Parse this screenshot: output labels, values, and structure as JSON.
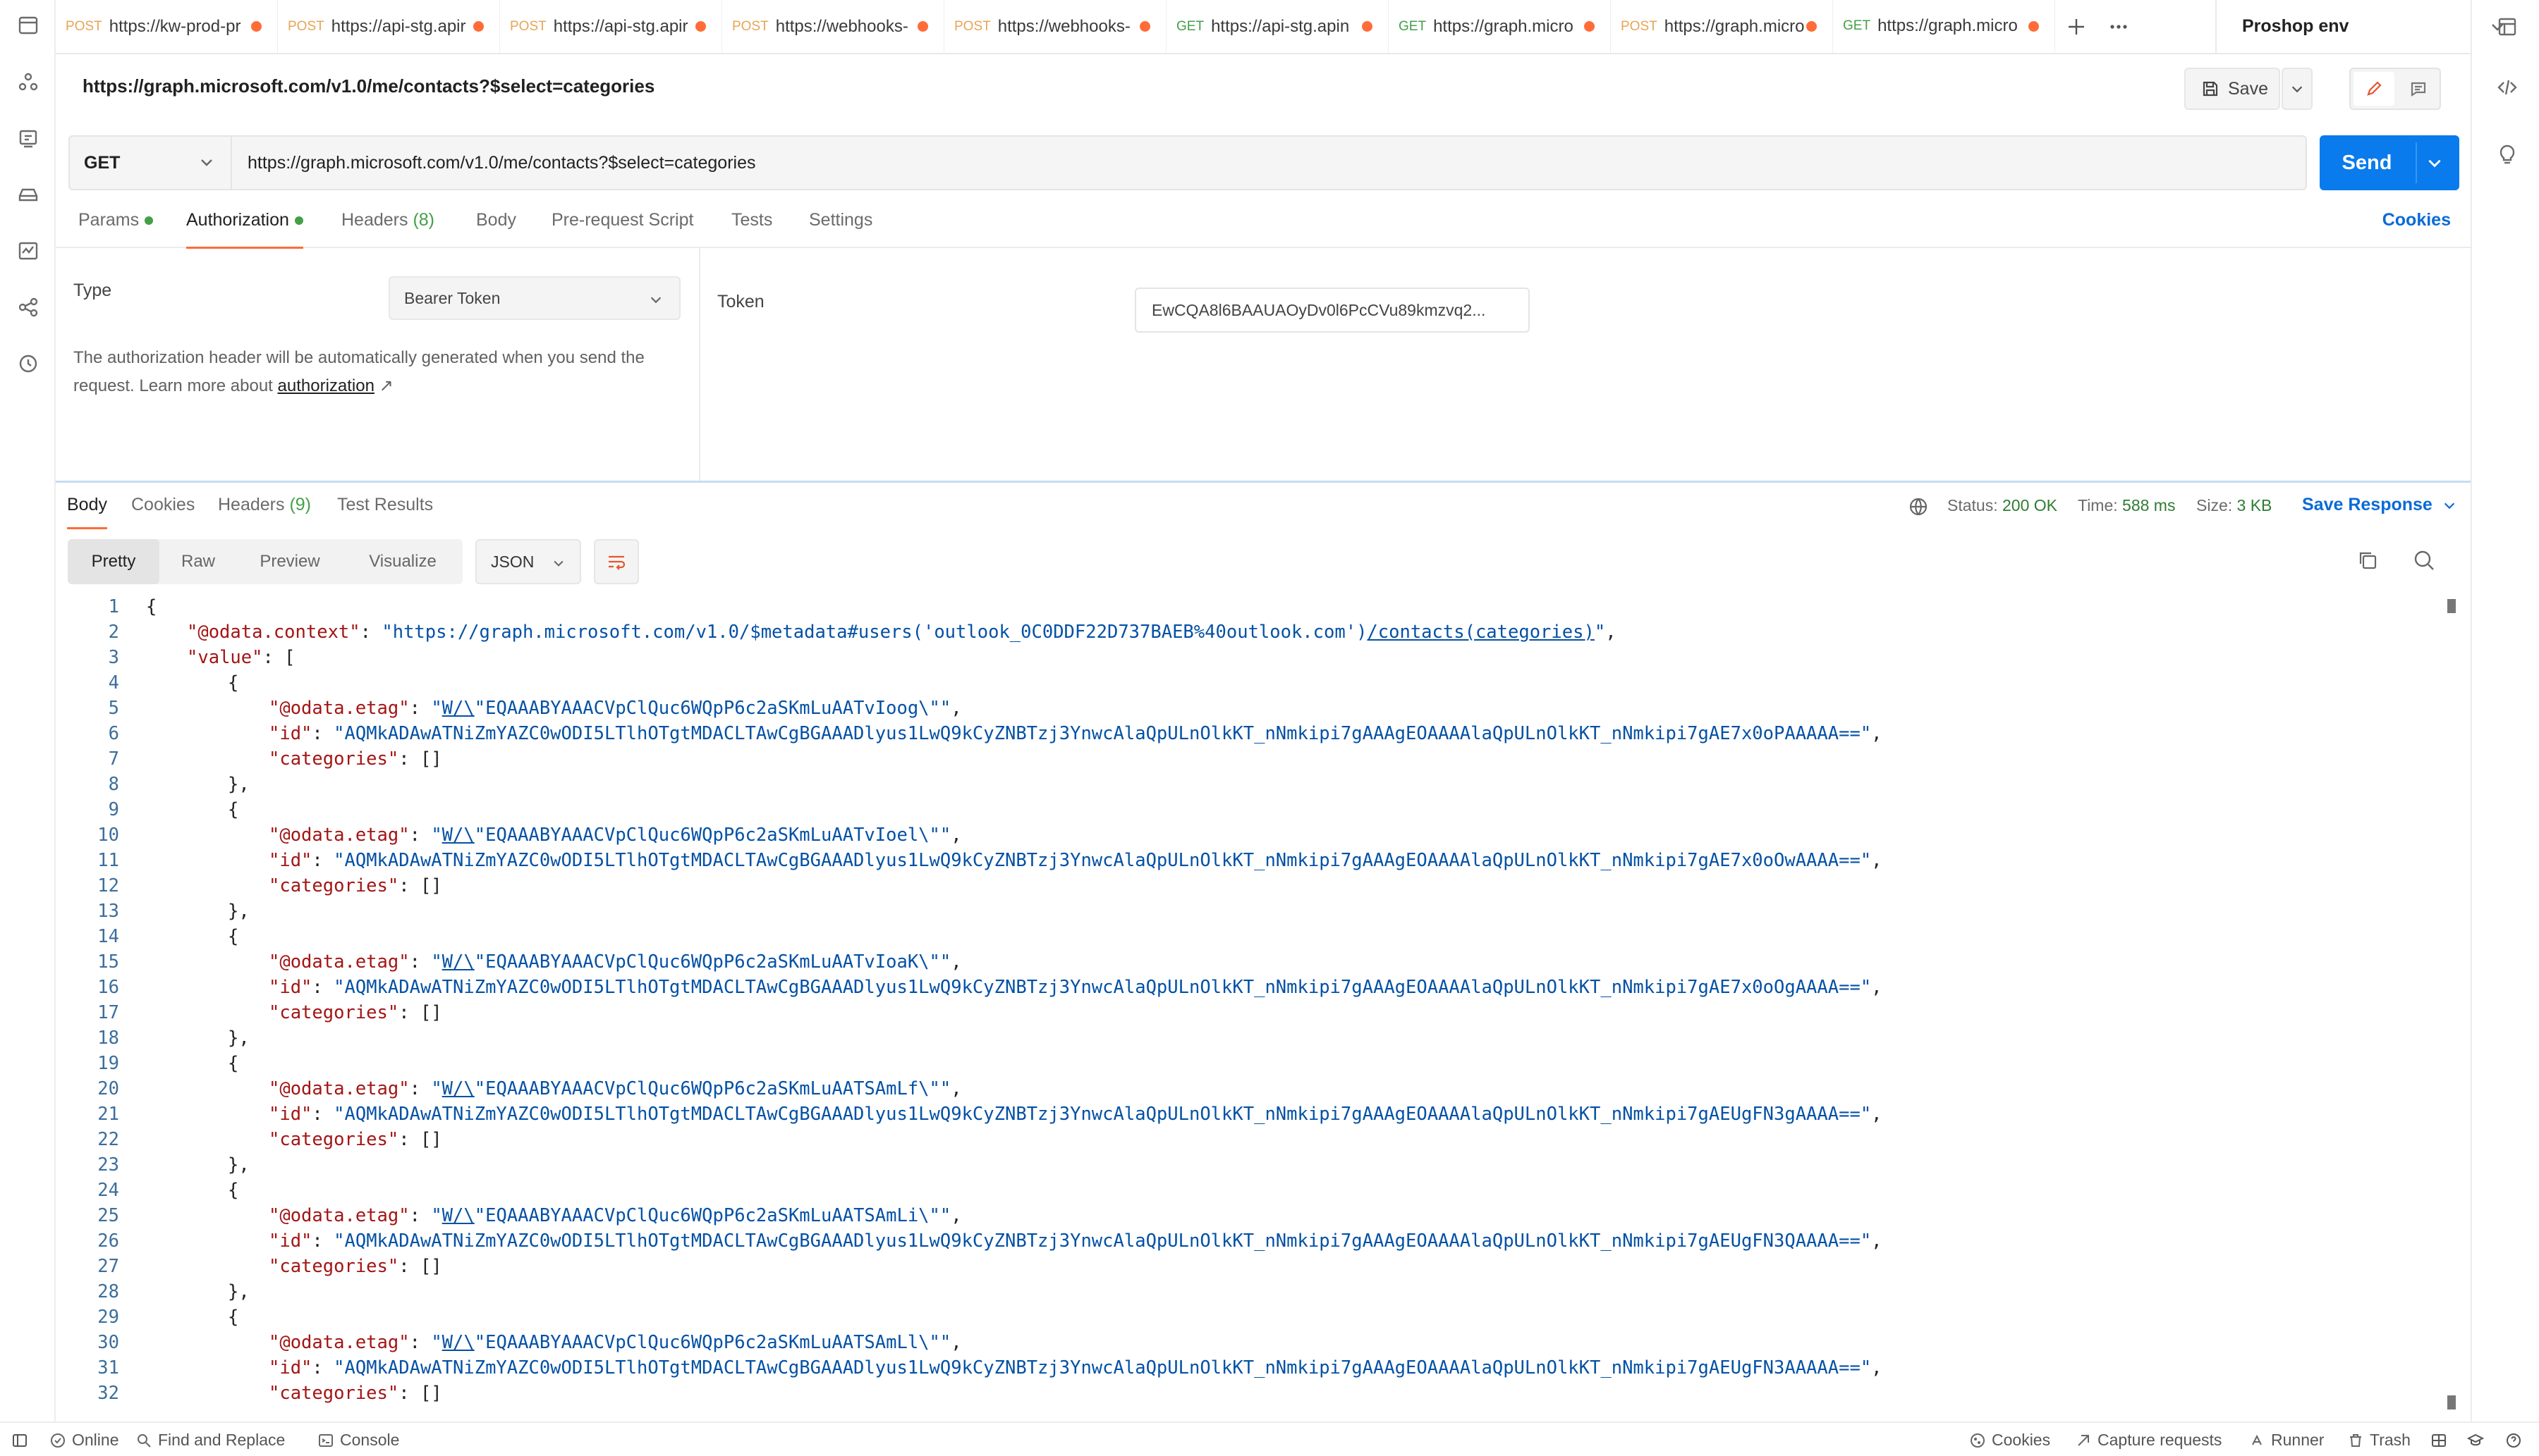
{
  "tabs": [
    {
      "method": "POST",
      "url": "https://kw-prod-pr"
    },
    {
      "method": "POST",
      "url": "https://api-stg.apir"
    },
    {
      "method": "POST",
      "url": "https://api-stg.apir"
    },
    {
      "method": "POST",
      "url": "https://webhooks-"
    },
    {
      "method": "POST",
      "url": "https://webhooks-"
    },
    {
      "method": "GET",
      "url": "https://api-stg.apin"
    },
    {
      "method": "GET",
      "url": "https://graph.micros"
    },
    {
      "method": "POST",
      "url": "https://graph.micro"
    },
    {
      "method": "GET",
      "url": "https://graph.micros"
    }
  ],
  "environment": "Proshop env",
  "request": {
    "title": "https://graph.microsoft.com/v1.0/me/contacts?$select=categories",
    "method": "GET",
    "url": "https://graph.microsoft.com/v1.0/me/contacts?$select=categories",
    "save_label": "Save",
    "send_label": "Send",
    "tabs": {
      "params": "Params",
      "authorization": "Authorization",
      "headers": "Headers",
      "headers_count": "(8)",
      "body": "Body",
      "prerequest": "Pre-request Script",
      "tests": "Tests",
      "settings": "Settings"
    },
    "cookies_label": "Cookies"
  },
  "auth": {
    "type_label": "Type",
    "type_value": "Bearer Token",
    "note": "The authorization header will be automatically generated when you send the request. Learn more about",
    "note_link": "authorization",
    "note_arrow": "↗",
    "token_label": "Token",
    "token_value": "EwCQA8l6BAAUAOyDv0l6PcCVu89kmzvq2..."
  },
  "response": {
    "tabs": {
      "body": "Body",
      "cookies": "Cookies",
      "headers": "Headers",
      "headers_count": "(9)",
      "test_results": "Test Results"
    },
    "status_label": "Status:",
    "status_value": "200 OK",
    "time_label": "Time:",
    "time_value": "588 ms",
    "size_label": "Size:",
    "size_value": "3 KB",
    "save_response": "Save Response",
    "formats": [
      "Pretty",
      "Raw",
      "Preview",
      "Visualize"
    ],
    "language": "JSON"
  },
  "code_lines": [
    {
      "n": "1",
      "i": 0,
      "segs": [
        [
          "p",
          "{"
        ]
      ]
    },
    {
      "n": "2",
      "i": 1,
      "segs": [
        [
          "k",
          "\"@odata.context\""
        ],
        [
          "p",
          ": "
        ],
        [
          "s",
          "\"https://graph.microsoft.com/v1.0/$metadata#users('outlook_0C0DDF22D737BAEB%40outlook.com')"
        ],
        [
          "l",
          "/contacts(categories)"
        ],
        [
          "s",
          "\""
        ],
        [
          "p",
          ","
        ]
      ]
    },
    {
      "n": "3",
      "i": 1,
      "segs": [
        [
          "k",
          "\"value\""
        ],
        [
          "p",
          ": ["
        ]
      ]
    },
    {
      "n": "4",
      "i": 2,
      "segs": [
        [
          "p",
          "{"
        ]
      ]
    },
    {
      "n": "5",
      "i": 3,
      "segs": [
        [
          "k",
          "\"@odata.etag\""
        ],
        [
          "p",
          ": "
        ],
        [
          "s",
          "\""
        ],
        [
          "l",
          "W/\\"
        ],
        [
          "s",
          "\"EQAAABYAAACVpClQuc6WQpP6c2aSKmLuAATvIoog\\\"\""
        ],
        [
          "p",
          ","
        ]
      ]
    },
    {
      "n": "6",
      "i": 3,
      "segs": [
        [
          "k",
          "\"id\""
        ],
        [
          "p",
          ": "
        ],
        [
          "s",
          "\"AQMkADAwATNiZmYAZC0wODI5LTlhOTgtMDACLTAwCgBGAAADlyus1LwQ9kCyZNBTzj3YnwcAlaQpULnOlkKT_nNmkipi7gAAAgEOAAAAlaQpULnOlkKT_nNmkipi7gAE7x0oPAAAAA==\""
        ],
        [
          "p",
          ","
        ]
      ]
    },
    {
      "n": "7",
      "i": 3,
      "segs": [
        [
          "k",
          "\"categories\""
        ],
        [
          "p",
          ": []"
        ]
      ]
    },
    {
      "n": "8",
      "i": 2,
      "segs": [
        [
          "p",
          "},"
        ]
      ]
    },
    {
      "n": "9",
      "i": 2,
      "segs": [
        [
          "p",
          "{"
        ]
      ]
    },
    {
      "n": "10",
      "i": 3,
      "segs": [
        [
          "k",
          "\"@odata.etag\""
        ],
        [
          "p",
          ": "
        ],
        [
          "s",
          "\""
        ],
        [
          "l",
          "W/\\"
        ],
        [
          "s",
          "\"EQAAABYAAACVpClQuc6WQpP6c2aSKmLuAATvIoel\\\"\""
        ],
        [
          "p",
          ","
        ]
      ]
    },
    {
      "n": "11",
      "i": 3,
      "segs": [
        [
          "k",
          "\"id\""
        ],
        [
          "p",
          ": "
        ],
        [
          "s",
          "\"AQMkADAwATNiZmYAZC0wODI5LTlhOTgtMDACLTAwCgBGAAADlyus1LwQ9kCyZNBTzj3YnwcAlaQpULnOlkKT_nNmkipi7gAAAgEOAAAAlaQpULnOlkKT_nNmkipi7gAE7x0oOwAAAA==\""
        ],
        [
          "p",
          ","
        ]
      ]
    },
    {
      "n": "12",
      "i": 3,
      "segs": [
        [
          "k",
          "\"categories\""
        ],
        [
          "p",
          ": []"
        ]
      ]
    },
    {
      "n": "13",
      "i": 2,
      "segs": [
        [
          "p",
          "},"
        ]
      ]
    },
    {
      "n": "14",
      "i": 2,
      "segs": [
        [
          "p",
          "{"
        ]
      ]
    },
    {
      "n": "15",
      "i": 3,
      "segs": [
        [
          "k",
          "\"@odata.etag\""
        ],
        [
          "p",
          ": "
        ],
        [
          "s",
          "\""
        ],
        [
          "l",
          "W/\\"
        ],
        [
          "s",
          "\"EQAAABYAAACVpClQuc6WQpP6c2aSKmLuAATvIoaK\\\"\""
        ],
        [
          "p",
          ","
        ]
      ]
    },
    {
      "n": "16",
      "i": 3,
      "segs": [
        [
          "k",
          "\"id\""
        ],
        [
          "p",
          ": "
        ],
        [
          "s",
          "\"AQMkADAwATNiZmYAZC0wODI5LTlhOTgtMDACLTAwCgBGAAADlyus1LwQ9kCyZNBTzj3YnwcAlaQpULnOlkKT_nNmkipi7gAAAgEOAAAAlaQpULnOlkKT_nNmkipi7gAE7x0oOgAAAA==\""
        ],
        [
          "p",
          ","
        ]
      ]
    },
    {
      "n": "17",
      "i": 3,
      "segs": [
        [
          "k",
          "\"categories\""
        ],
        [
          "p",
          ": []"
        ]
      ]
    },
    {
      "n": "18",
      "i": 2,
      "segs": [
        [
          "p",
          "},"
        ]
      ]
    },
    {
      "n": "19",
      "i": 2,
      "segs": [
        [
          "p",
          "{"
        ]
      ]
    },
    {
      "n": "20",
      "i": 3,
      "segs": [
        [
          "k",
          "\"@odata.etag\""
        ],
        [
          "p",
          ": "
        ],
        [
          "s",
          "\""
        ],
        [
          "l",
          "W/\\"
        ],
        [
          "s",
          "\"EQAAABYAAACVpClQuc6WQpP6c2aSKmLuAATSAmLf\\\"\""
        ],
        [
          "p",
          ","
        ]
      ]
    },
    {
      "n": "21",
      "i": 3,
      "segs": [
        [
          "k",
          "\"id\""
        ],
        [
          "p",
          ": "
        ],
        [
          "s",
          "\"AQMkADAwATNiZmYAZC0wODI5LTlhOTgtMDACLTAwCgBGAAADlyus1LwQ9kCyZNBTzj3YnwcAlaQpULnOlkKT_nNmkipi7gAAAgEOAAAAlaQpULnOlkKT_nNmkipi7gAEUgFN3gAAAA==\""
        ],
        [
          "p",
          ","
        ]
      ]
    },
    {
      "n": "22",
      "i": 3,
      "segs": [
        [
          "k",
          "\"categories\""
        ],
        [
          "p",
          ": []"
        ]
      ]
    },
    {
      "n": "23",
      "i": 2,
      "segs": [
        [
          "p",
          "},"
        ]
      ]
    },
    {
      "n": "24",
      "i": 2,
      "segs": [
        [
          "p",
          "{"
        ]
      ]
    },
    {
      "n": "25",
      "i": 3,
      "segs": [
        [
          "k",
          "\"@odata.etag\""
        ],
        [
          "p",
          ": "
        ],
        [
          "s",
          "\""
        ],
        [
          "l",
          "W/\\"
        ],
        [
          "s",
          "\"EQAAABYAAACVpClQuc6WQpP6c2aSKmLuAATSAmLi\\\"\""
        ],
        [
          "p",
          ","
        ]
      ]
    },
    {
      "n": "26",
      "i": 3,
      "segs": [
        [
          "k",
          "\"id\""
        ],
        [
          "p",
          ": "
        ],
        [
          "s",
          "\"AQMkADAwATNiZmYAZC0wODI5LTlhOTgtMDACLTAwCgBGAAADlyus1LwQ9kCyZNBTzj3YnwcAlaQpULnOlkKT_nNmkipi7gAAAgEOAAAAlaQpULnOlkKT_nNmkipi7gAEUgFN3QAAAA==\""
        ],
        [
          "p",
          ","
        ]
      ]
    },
    {
      "n": "27",
      "i": 3,
      "segs": [
        [
          "k",
          "\"categories\""
        ],
        [
          "p",
          ": []"
        ]
      ]
    },
    {
      "n": "28",
      "i": 2,
      "segs": [
        [
          "p",
          "},"
        ]
      ]
    },
    {
      "n": "29",
      "i": 2,
      "segs": [
        [
          "p",
          "{"
        ]
      ]
    },
    {
      "n": "30",
      "i": 3,
      "segs": [
        [
          "k",
          "\"@odata.etag\""
        ],
        [
          "p",
          ": "
        ],
        [
          "s",
          "\""
        ],
        [
          "l",
          "W/\\"
        ],
        [
          "s",
          "\"EQAAABYAAACVpClQuc6WQpP6c2aSKmLuAATSAmLl\\\"\""
        ],
        [
          "p",
          ","
        ]
      ]
    },
    {
      "n": "31",
      "i": 3,
      "segs": [
        [
          "k",
          "\"id\""
        ],
        [
          "p",
          ": "
        ],
        [
          "s",
          "\"AQMkADAwATNiZmYAZC0wODI5LTlhOTgtMDACLTAwCgBGAAADlyus1LwQ9kCyZNBTzj3YnwcAlaQpULnOlkKT_nNmkipi7gAAAgEOAAAAlaQpULnOlkKT_nNmkipi7gAEUgFN3AAAAA==\""
        ],
        [
          "p",
          ","
        ]
      ]
    },
    {
      "n": "32",
      "i": 3,
      "segs": [
        [
          "k",
          "\"categories\""
        ],
        [
          "p",
          ": []"
        ]
      ]
    }
  ],
  "statusbar": {
    "online": "Online",
    "find_replace": "Find and Replace",
    "console": "Console",
    "cookies": "Cookies",
    "capture": "Capture requests",
    "runner": "Runner",
    "trash": "Trash"
  },
  "colors": {
    "accent": "#ff6c37",
    "send": "#097bed",
    "status_ok": "#2e7d32",
    "json_key": "#a31515",
    "json_string": "#0451a5"
  }
}
